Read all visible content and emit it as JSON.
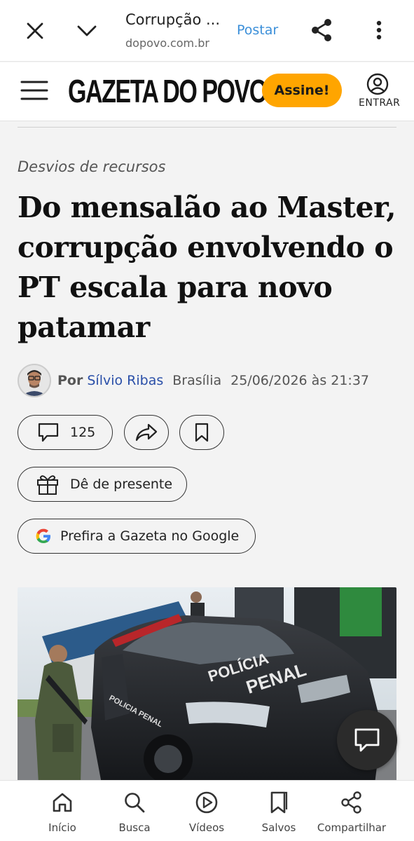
{
  "browser": {
    "title": "Corrupção ...",
    "url": "dopovo.com.br",
    "post_label": "Postar"
  },
  "site": {
    "logo": "GAZETA DO POVO",
    "subscribe_label": "Assine!",
    "login_label": "ENTRAR"
  },
  "article": {
    "kicker": "Desvios de recursos",
    "headline": "Do mensalão ao Master, corrupção envolvendo o PT escala para novo patamar",
    "byline": {
      "prefix": "Por",
      "author": "Sílvio Ribas",
      "place": "Brasília",
      "datetime": "25/06/2026 às 21:37"
    },
    "comment_count": "125",
    "gift_label": "Dê de presente",
    "google_label": "Prefira a Gazeta no Google",
    "photo": {
      "car_text_1": "POLÍCIA",
      "car_text_2": "PENAL",
      "door_text": "POLICIA PENAL"
    }
  },
  "bottom_nav": [
    {
      "label": "Início",
      "icon": "home-icon"
    },
    {
      "label": "Busca",
      "icon": "search-icon"
    },
    {
      "label": "Vídeos",
      "icon": "play-icon"
    },
    {
      "label": "Salvos",
      "icon": "bookmark-icon"
    },
    {
      "label": "Compartilhar",
      "icon": "share-icon"
    }
  ],
  "colors": {
    "accent_orange": "#ffa500",
    "author_link": "#2a4fa8",
    "post_link": "#3b8fd9"
  }
}
